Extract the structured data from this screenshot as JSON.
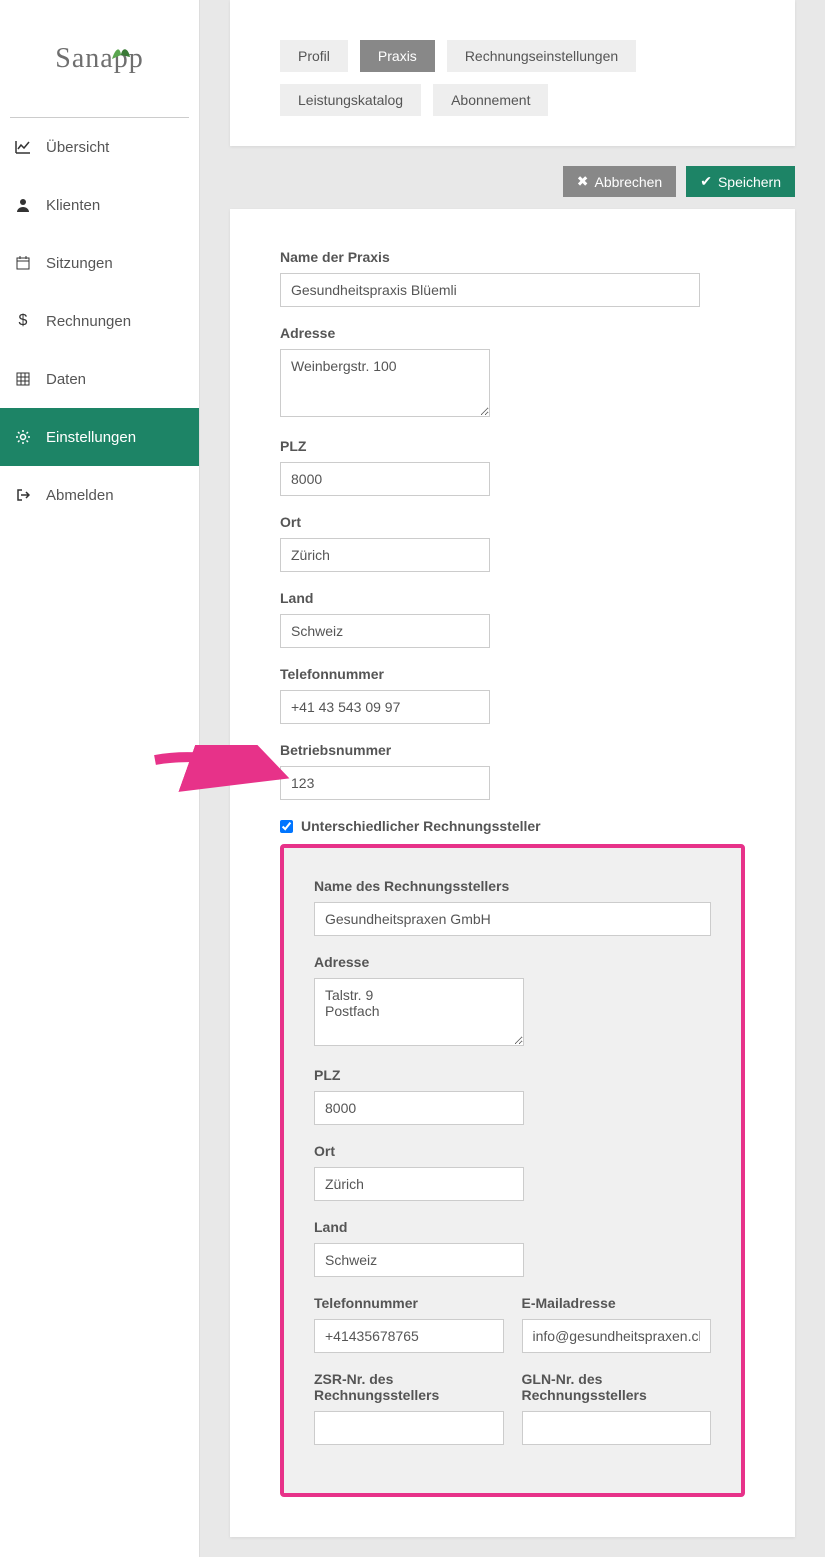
{
  "brand": "Sanapp",
  "sidebar": {
    "items": [
      {
        "label": "Übersicht"
      },
      {
        "label": "Klienten"
      },
      {
        "label": "Sitzungen"
      },
      {
        "label": "Rechnungen"
      },
      {
        "label": "Daten"
      },
      {
        "label": "Einstellungen"
      },
      {
        "label": "Abmelden"
      }
    ]
  },
  "tabs": [
    {
      "label": "Profil"
    },
    {
      "label": "Praxis"
    },
    {
      "label": "Rechnungseinstellungen"
    },
    {
      "label": "Leistungskatalog"
    },
    {
      "label": "Abonnement"
    }
  ],
  "actions": {
    "cancel": "Abbrechen",
    "save": "Speichern"
  },
  "form": {
    "practice_name_label": "Name der Praxis",
    "practice_name": "Gesundheitspraxis Blüemli",
    "address_label": "Adresse",
    "address": "Weinbergstr. 100",
    "zip_label": "PLZ",
    "zip": "8000",
    "city_label": "Ort",
    "city": "Zürich",
    "country_label": "Land",
    "country": "Schweiz",
    "phone_label": "Telefonnummer",
    "phone": "+41 43 543 09 97",
    "opnum_label": "Betriebsnummer",
    "opnum": "123",
    "diff_biller_label": "Unterschiedlicher Rechnungssteller",
    "diff_biller_checked": true
  },
  "biller": {
    "name_label": "Name des Rechnungsstellers",
    "name": "Gesundheitspraxen GmbH",
    "address_label": "Adresse",
    "address": "Talstr. 9\nPostfach",
    "zip_label": "PLZ",
    "zip": "8000",
    "city_label": "Ort",
    "city": "Zürich",
    "country_label": "Land",
    "country": "Schweiz",
    "phone_label": "Telefonnummer",
    "phone": "+41435678765",
    "email_label": "E-Mailadresse",
    "email": "info@gesundheitspraxen.ch",
    "zsr_label": "ZSR-Nr. des Rechnungsstellers",
    "zsr": "",
    "gln_label": "GLN-Nr. des Rechnungsstellers",
    "gln": ""
  }
}
